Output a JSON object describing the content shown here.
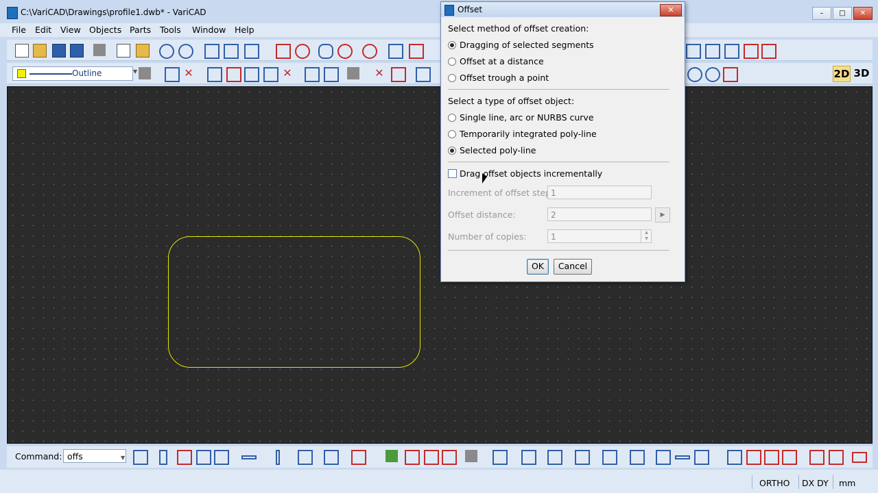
{
  "window": {
    "title": "C:\\VariCAD\\Drawings\\profile1.dwb* - VariCAD",
    "minimize_icon": "minimize-icon",
    "maximize_icon": "maximize-icon",
    "close_glyph": "✕"
  },
  "menu": {
    "file": "File",
    "edit": "Edit",
    "view": "View",
    "objects": "Objects",
    "parts": "Parts",
    "tools": "Tools",
    "window": "Window",
    "help": "Help"
  },
  "toolbar2": {
    "layer_label": "Outline",
    "layer_color": "#f2f200",
    "mode_2d": "2D",
    "mode_3d": "3D"
  },
  "canvas": {
    "background": "#2b2b2b",
    "outline_color": "#e4e400"
  },
  "dialog": {
    "title": "Offset",
    "method_heading": "Select method of offset creation:",
    "method_options": [
      "Dragging of selected segments",
      "Offset at a distance",
      "Offset trough a point"
    ],
    "method_selected": "Dragging of selected segments",
    "type_heading": "Select a type of offset object:",
    "type_options": [
      "Single line, arc or NURBS curve",
      "Temporarily integrated poly-line",
      "Selected poly-line"
    ],
    "type_selected": "Selected poly-line",
    "drag_checkbox_label": "Drag offset objects incrementally",
    "drag_checkbox_checked": false,
    "increment_label": "Increment of offset step:",
    "increment_value": "1",
    "distance_label": "Offset distance:",
    "distance_value": "2",
    "copies_label": "Number of copies:",
    "copies_value": "1",
    "ok_label": "OK",
    "cancel_label": "Cancel"
  },
  "command": {
    "label": "Command:",
    "value": "offs"
  },
  "status": {
    "ortho": "ORTHO",
    "dxdy": "DX DY",
    "units": "mm"
  }
}
